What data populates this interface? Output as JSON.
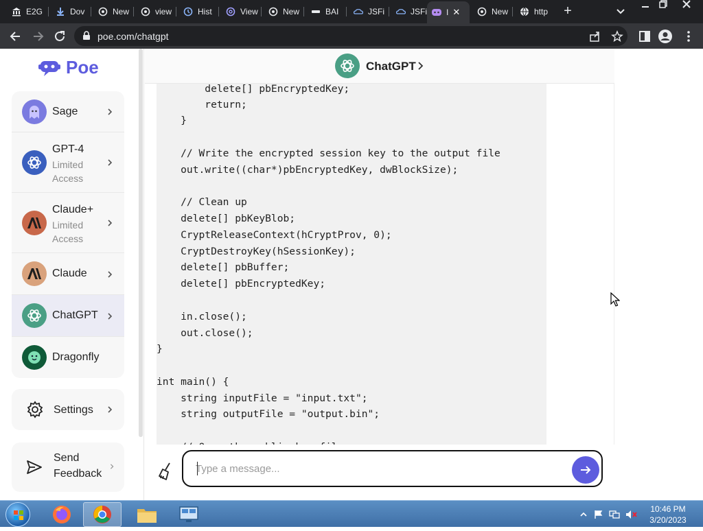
{
  "browser": {
    "tabs": [
      {
        "label": "E2G",
        "icon": "bank-icon"
      },
      {
        "label": "Dov",
        "icon": "download-icon"
      },
      {
        "label": "New",
        "icon": "openai-icon"
      },
      {
        "label": "view",
        "icon": "openai-icon"
      },
      {
        "label": "Hist",
        "icon": "history-icon"
      },
      {
        "label": "View",
        "icon": "at-icon"
      },
      {
        "label": "New",
        "icon": "openai-icon"
      },
      {
        "label": "BAI",
        "icon": "bai-icon"
      },
      {
        "label": "JSFi",
        "icon": "jsfiddle-icon"
      },
      {
        "label": "JSFi",
        "icon": "jsfiddle-icon"
      },
      {
        "label": "I",
        "icon": "poe-icon",
        "active": true
      },
      {
        "label": "New",
        "icon": "openai-icon"
      },
      {
        "label": "http",
        "icon": "globe-icon"
      }
    ],
    "url": "poe.com/chatgpt"
  },
  "sidebar": {
    "logo": "Poe",
    "bots": [
      {
        "name": "Sage",
        "sub": "",
        "color": "#6f6fd8",
        "icon": "sage-avatar"
      },
      {
        "name": "GPT-4",
        "sub": "Limited Access",
        "color": "#3a5fbe",
        "icon": "openai-icon"
      },
      {
        "name": "Claude+",
        "sub": "Limited Access",
        "color": "#c8684a",
        "icon": "anthropic-icon"
      },
      {
        "name": "Claude",
        "sub": "",
        "color": "#d9a27c",
        "icon": "anthropic-icon"
      },
      {
        "name": "ChatGPT",
        "sub": "",
        "color": "#4a9f85",
        "icon": "openai-icon",
        "active": true
      },
      {
        "name": "Dragonfly",
        "sub": "",
        "color": "#1d7a4e",
        "icon": "dragonfly-avatar"
      }
    ],
    "settings_label": "Settings",
    "feedback_label": "Send Feedback",
    "feedback_line1": "Send",
    "feedback_line2": "Feedback"
  },
  "chat": {
    "bot_name": "ChatGPT",
    "code_lines": [
      "        delete[] pbEncryptedKey;",
      "        return;",
      "    }",
      "",
      "    // Write the encrypted session key to the output file",
      "    out.write((char*)pbEncryptedKey, dwBlockSize);",
      "",
      "    // Clean up",
      "    delete[] pbKeyBlob;",
      "    CryptReleaseContext(hCryptProv, 0);",
      "    CryptDestroyKey(hSessionKey);",
      "    delete[] pbBuffer;",
      "    delete[] pbEncryptedKey;",
      "",
      "    in.close();",
      "    out.close();",
      "}",
      "",
      "int main() {",
      "    string inputFile = \"input.txt\";",
      "    string outputFile = \"output.bin\";",
      "",
      "    // Open the public key file"
    ],
    "input_placeholder": "Type a message..."
  },
  "taskbar": {
    "time": "10:46 PM",
    "date": "3/20/2023"
  }
}
